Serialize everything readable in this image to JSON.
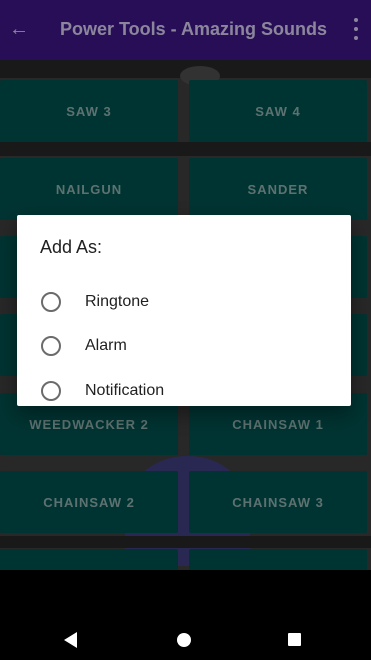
{
  "app_bar": {
    "title": "Power Tools - Amazing Sounds"
  },
  "tiles": [
    {
      "label": "SAW 3"
    },
    {
      "label": "SAW 4"
    },
    {
      "label": "NAILGUN"
    },
    {
      "label": "SANDER"
    },
    {
      "label": "WEEDWACKER 2"
    },
    {
      "label": "CHAINSAW 1"
    },
    {
      "label": "CHAINSAW 2"
    },
    {
      "label": "CHAINSAW 3"
    }
  ],
  "dialog": {
    "title": "Add As:",
    "options": [
      {
        "label": "Ringtone",
        "selected": false
      },
      {
        "label": "Alarm",
        "selected": false
      },
      {
        "label": "Notification",
        "selected": false
      }
    ]
  },
  "colors": {
    "app_bar": "#3a1680",
    "tile": "#004d4a",
    "dialog_bg": "#ffffff"
  },
  "icons": {
    "back": "arrow-left-icon",
    "menu": "more-vertical-icon",
    "nav_back": "triangle-back-icon",
    "nav_home": "circle-home-icon",
    "nav_recent": "square-recents-icon"
  }
}
